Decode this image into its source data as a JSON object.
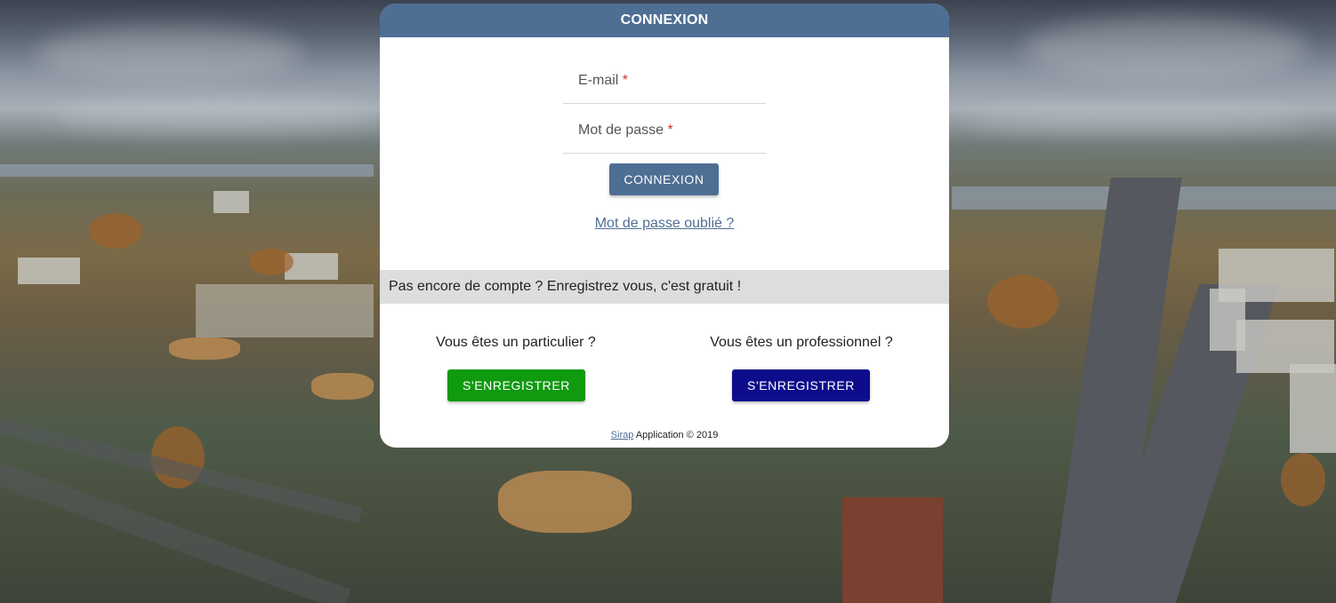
{
  "header": {
    "title": "CONNEXION"
  },
  "login_form": {
    "email_label": "E-mail",
    "password_label": "Mot de passe",
    "required_mark": "*",
    "submit_label": "CONNEXION",
    "forgot_link": "Mot de passe oublié ?"
  },
  "register": {
    "notice": "Pas encore de compte ? Enregistrez vous, c'est gratuit !",
    "individual_question": "Vous êtes un particulier ?",
    "individual_button": "S'ENREGISTRER",
    "professional_question": "Vous êtes un professionnel ?",
    "professional_button": "S'ENREGISTRER"
  },
  "footer": {
    "link_text": "Sirap",
    "text": " Application © 2019"
  },
  "colors": {
    "header_bg": "#4f6e94",
    "individual_button_bg": "#109a10",
    "professional_button_bg": "#0d0d8c",
    "required_mark": "#d32f2f"
  }
}
